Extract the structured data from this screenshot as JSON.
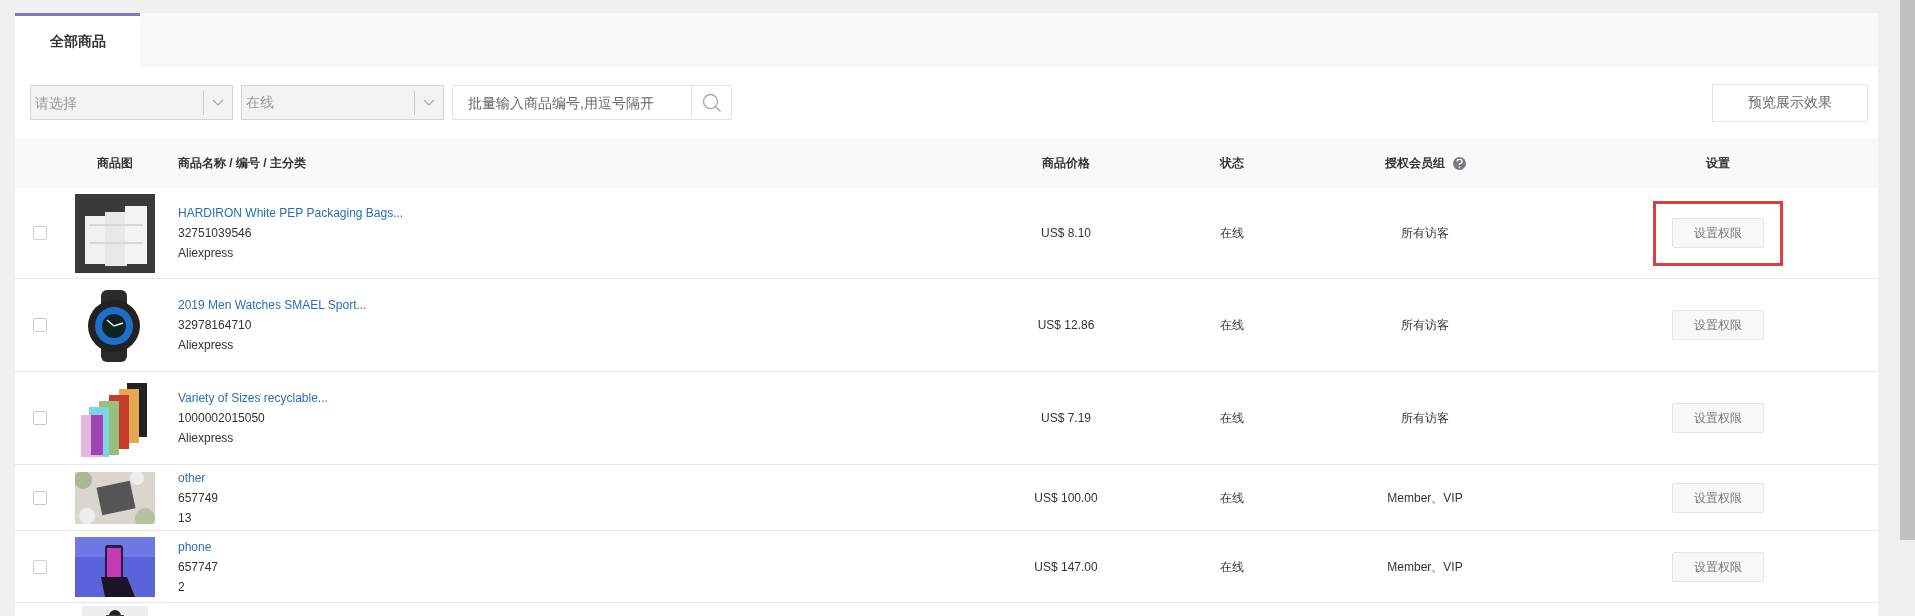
{
  "tabs": [
    {
      "label": "全部商品",
      "selected": true
    }
  ],
  "filters": {
    "category": {
      "placeholder": "请选择"
    },
    "status": {
      "value": "在线"
    },
    "search": {
      "placeholder": "批量输入商品编号,用逗号隔开"
    },
    "preview_button": "预览展示效果"
  },
  "table": {
    "columns": [
      "商品图",
      "商品名称 / 编号 / 主分类",
      "商品价格",
      "状态",
      "授权会员组",
      "设置"
    ],
    "rows": [
      {
        "checked": false,
        "name": "HARDIRON White PEP Packaging Bags...",
        "id": "32751039546",
        "category": "Aliexpress",
        "price": "US$ 8.10",
        "status": "在线",
        "group": "所有访客",
        "action": "设置权限",
        "highlighted": true
      },
      {
        "checked": false,
        "name": "2019 Men Watches SMAEL Sport...",
        "id": "32978164710",
        "category": "Aliexpress",
        "price": "US$ 12.86",
        "status": "在线",
        "group": "所有访客",
        "action": "设置权限",
        "highlighted": false
      },
      {
        "checked": false,
        "name": "Variety of Sizes recyclable...",
        "id": "1000002015050",
        "category": "Aliexpress",
        "price": "US$ 7.19",
        "status": "在线",
        "group": "所有访客",
        "action": "设置权限",
        "highlighted": false
      },
      {
        "checked": false,
        "name": "other",
        "id": "657749",
        "category": "13",
        "price": "US$ 100.00",
        "status": "在线",
        "group": "Member、VIP",
        "action": "设置权限",
        "highlighted": false
      },
      {
        "checked": false,
        "name": "phone",
        "id": "657747",
        "category": "2",
        "price": "US$ 147.00",
        "status": "在线",
        "group": "Member、VIP",
        "action": "设置权限",
        "highlighted": false
      }
    ]
  }
}
